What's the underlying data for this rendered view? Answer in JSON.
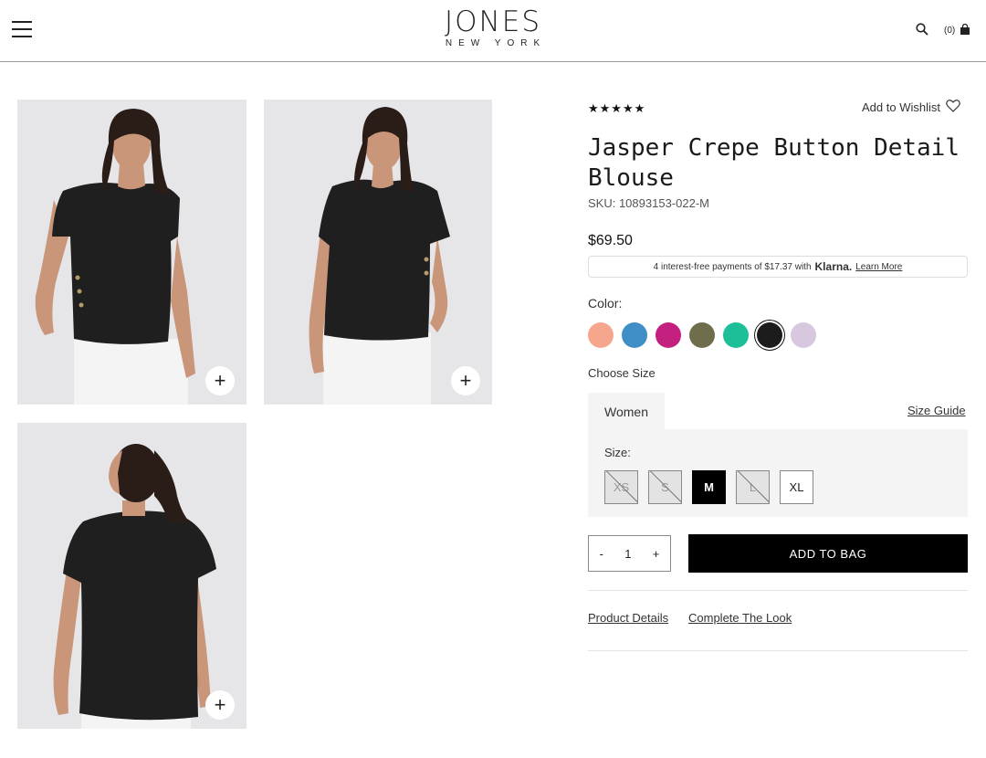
{
  "header": {
    "logo_main": "JONES",
    "logo_sub": "NEW YORK",
    "cart_count": "(0)"
  },
  "product": {
    "stars": "★★★★★",
    "wishlist_label": "Add to Wishlist",
    "title": "Jasper Crepe Button Detail Blouse",
    "sku": "SKU: 10893153-022-M",
    "price": "$69.50",
    "klarna_text": "4 interest-free payments of $17.37 with",
    "klarna_brand": "Klarna.",
    "klarna_link": "Learn More",
    "color_label": "Color:",
    "colors": [
      "#f7a68e",
      "#3f8fc6",
      "#c4207f",
      "#6f6e4c",
      "#1cbf98",
      "#1c1c1c",
      "#d8c8df"
    ],
    "selected_color_index": 5,
    "choose_size_label": "Choose Size",
    "size_tab": "Women",
    "size_guide": "Size Guide",
    "size_label": "Size:",
    "sizes": [
      {
        "label": "XS",
        "state": "unavailable"
      },
      {
        "label": "S",
        "state": "unavailable"
      },
      {
        "label": "M",
        "state": "selected"
      },
      {
        "label": "L",
        "state": "unavailable"
      },
      {
        "label": "XL",
        "state": "available"
      }
    ],
    "qty_minus": "-",
    "qty_value": "1",
    "qty_plus": "+",
    "add_to_bag": "ADD TO BAG",
    "links": [
      "Product Details",
      "Complete The Look"
    ]
  },
  "gallery": {
    "zoom_icon": "+"
  }
}
